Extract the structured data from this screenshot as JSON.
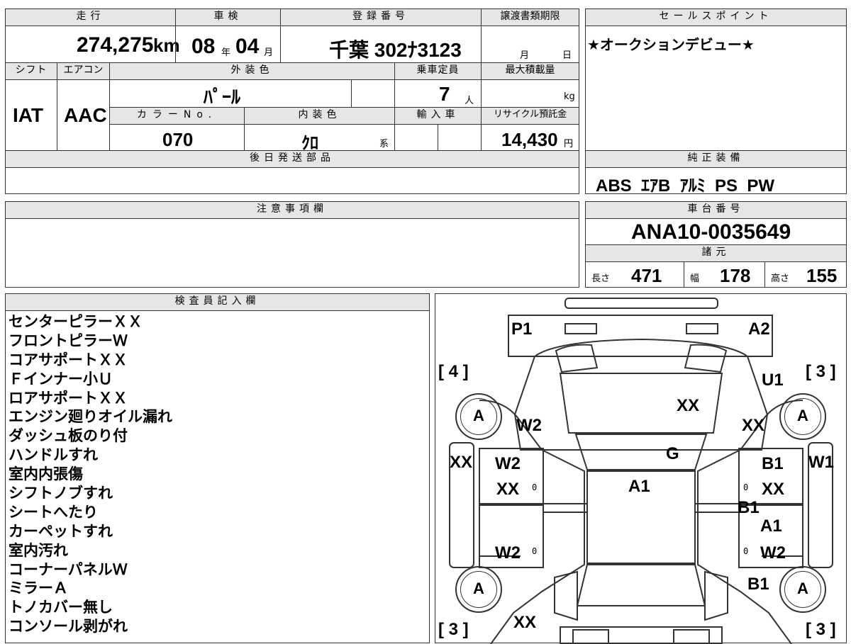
{
  "mileage": {
    "label": "走行",
    "value": "274,275",
    "unit": "km"
  },
  "inspection": {
    "label": "車検",
    "year": "08",
    "year_unit": "年",
    "month": "04",
    "month_unit": "月"
  },
  "registration": {
    "label": "登録番号",
    "value": "千葉 302ﾅ3123"
  },
  "transfer": {
    "label": "譲渡書類期限",
    "month_unit": "月",
    "day_unit": "日"
  },
  "shift": {
    "label": "シフト",
    "value": "IAT"
  },
  "aircon": {
    "label": "エアコン",
    "value": "AAC"
  },
  "exterior_color": {
    "label": "外装色",
    "value": "ﾊﾟｰﾙ"
  },
  "capacity": {
    "label": "乗車定員",
    "value": "7",
    "unit": "人"
  },
  "max_load": {
    "label": "最大積載量",
    "unit": "kg"
  },
  "color_no": {
    "label": "カラーNo.",
    "value": "070"
  },
  "interior_color": {
    "label": "内装色",
    "value": "ｸﾛ",
    "suffix": "系"
  },
  "import": {
    "label": "輸入車"
  },
  "recycle": {
    "label": "リサイクル預託金",
    "value": "14,430",
    "unit": "円"
  },
  "later_parts": {
    "label": "後日発送部品"
  },
  "notes": {
    "label": "注意事項欄"
  },
  "sales_point": {
    "label": "セールスポイント",
    "value": "★オークションデビュー★"
  },
  "equipment": {
    "label": "純正装備",
    "value": "ABS  ｴｱB  ｱﾙﾐ  PS  PW"
  },
  "chassis": {
    "label": "車台番号",
    "value": "ANA10-0035649"
  },
  "specs": {
    "label": "諸元",
    "length_label": "長さ",
    "length": "471",
    "width_label": "幅",
    "width": "178",
    "height_label": "高さ",
    "height": "155"
  },
  "inspector": {
    "label": "検査員記入欄",
    "lines": [
      "センターピラーＸＸ",
      "フロントピラーＷ",
      "コアサポートＸＸ",
      "Ｆインナー小Ｕ",
      "ロアサポートＸＸ",
      "エンジン廻りオイル漏れ",
      "ダッシュ板のり付",
      "ハンドルすれ",
      "室内内張傷",
      "シフトノブすれ",
      "シートへたり",
      "カーペットすれ",
      "室内汚れ",
      "コーナーパネルＷ",
      "ミラーＡ",
      "トノカバー無し",
      "コンソール剥がれ"
    ]
  },
  "diagram": {
    "marks": {
      "p1": "P1",
      "a2": "A2",
      "left4": "[ 4 ]",
      "right3top": "[ 3 ]",
      "u1": "U1",
      "tire_fl": "A",
      "tire_fr": "A",
      "tire_rl": "A",
      "tire_rr": "A",
      "w2_fl": "W2",
      "xx_hood": "XX",
      "xx_fr": "XX",
      "g": "G",
      "a1_center": "A1",
      "xx_left_side": "XX",
      "w1_right_side": "W1",
      "w2_ld1": "W2",
      "xx_ld1": "XX",
      "b1_rd1": "B1",
      "xx_rd1": "XX",
      "b1_mid": "B1",
      "a1_rd2": "A1",
      "w2_ld2": "W2",
      "w2_rd2": "W2",
      "b1_rear": "B1",
      "left3bot": "[ 3 ]",
      "right3bot": "[ 3 ]",
      "xx_rear": "XX",
      "zero": "0"
    }
  }
}
